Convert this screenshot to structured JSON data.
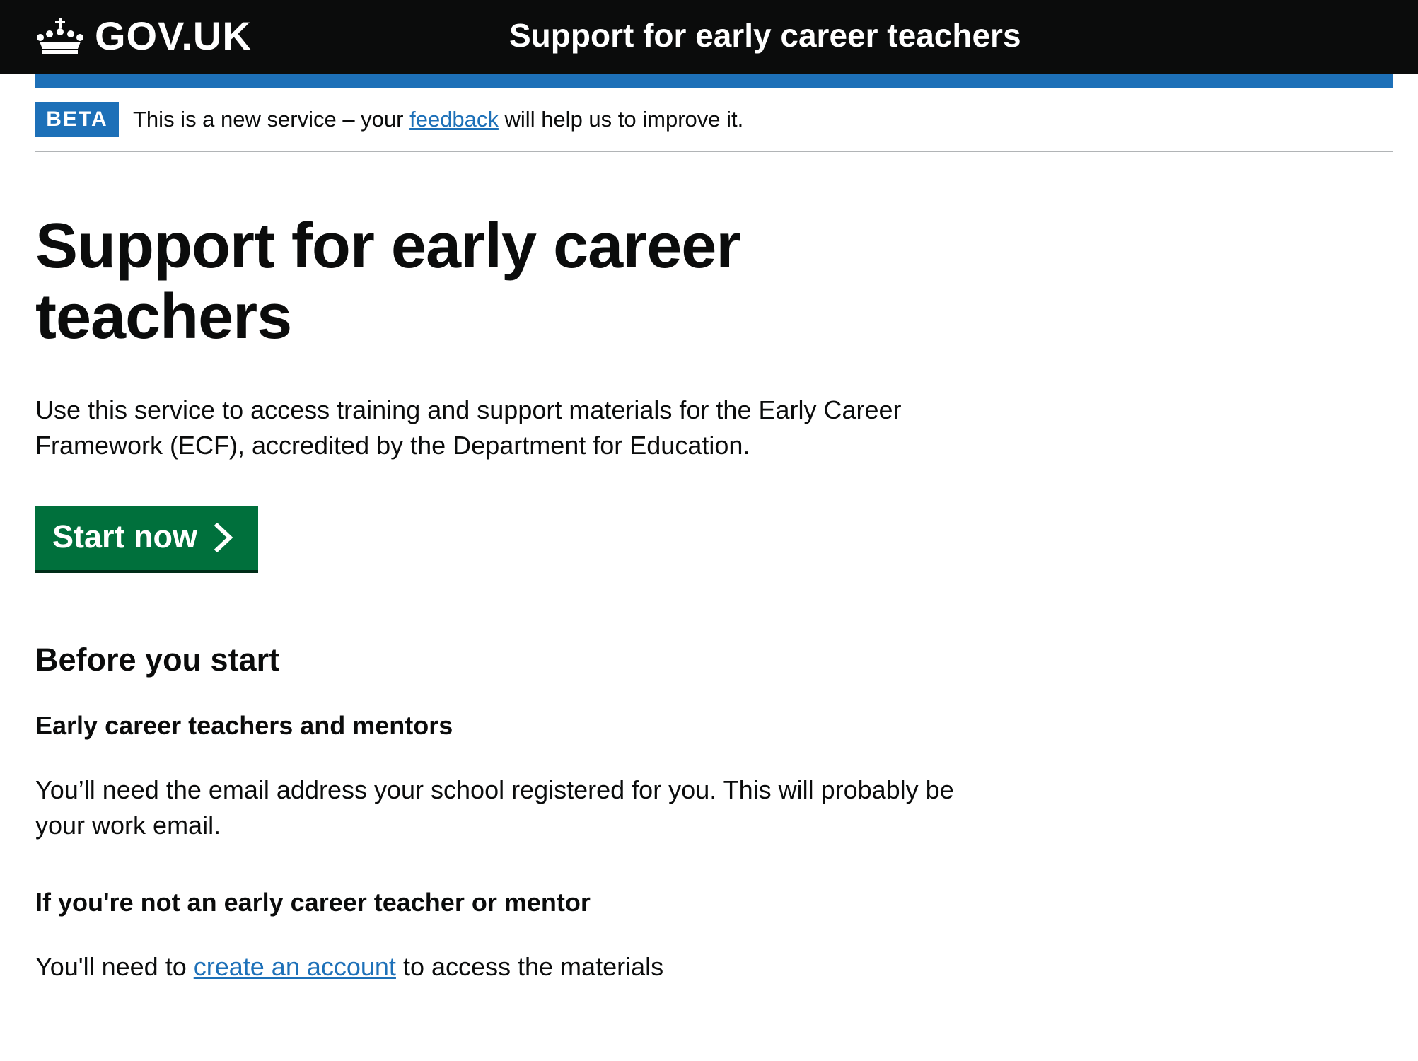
{
  "header": {
    "logo_text": "GOV.UK",
    "service_name": "Support for early career teachers",
    "background": "#0b0c0c",
    "accent": "#1d70b8"
  },
  "phase_banner": {
    "tag": "BETA",
    "text_before": "This is a new service – your ",
    "link_text": "feedback",
    "text_after": " will help us to improve it."
  },
  "main": {
    "title": "Support for early career teachers",
    "lead": "Use this service to access training and support materials for the Early Career Framework (ECF), accredited by the Department for Education.",
    "start_button": {
      "label": "Start now",
      "icon": "chevron-right-icon",
      "color": "#00703c"
    },
    "before_heading": "Before you start",
    "sections": [
      {
        "heading": "Early career teachers and mentors",
        "text": "You’ll need the email address your school registered for you. This will probably be your work email."
      },
      {
        "heading": "If you're not an early career teacher or mentor",
        "text_before": "You'll need to ",
        "link_text": "create an account",
        "text_after": " to access the materials"
      }
    ]
  }
}
